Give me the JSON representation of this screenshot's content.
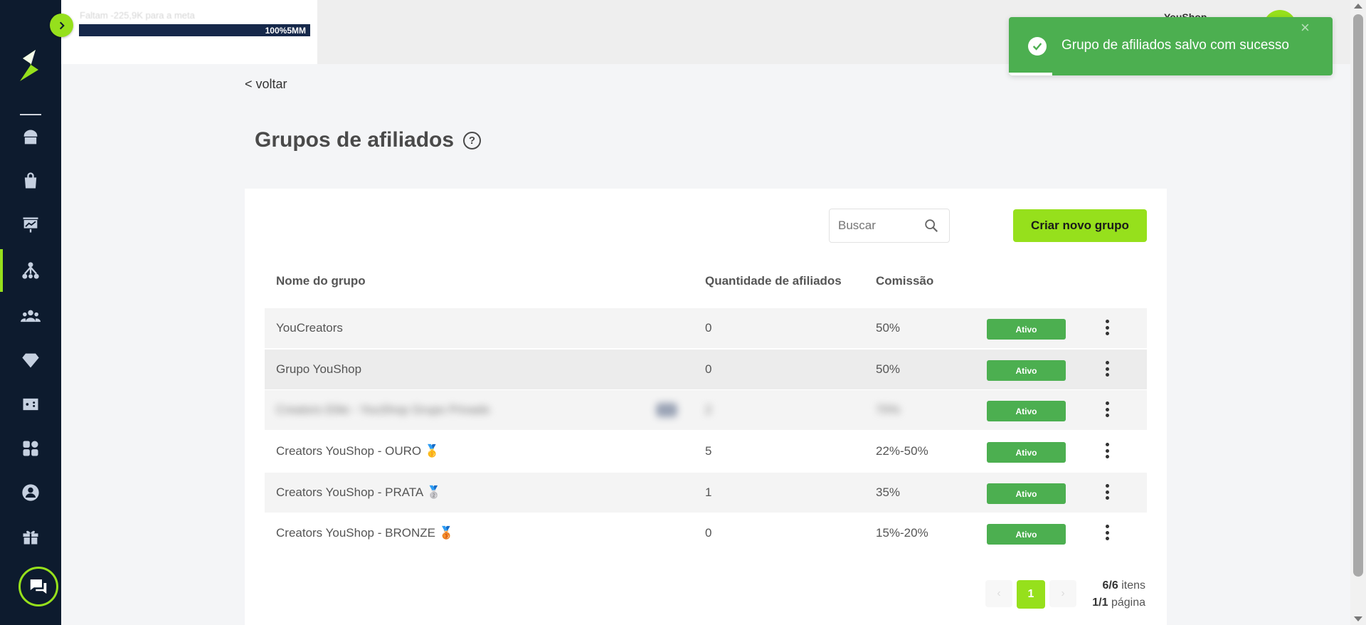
{
  "goal": {
    "text": "Faltam -225,9K para a meta",
    "percent": "100%",
    "target": "5MM"
  },
  "user": {
    "name": "YouShop"
  },
  "toast": {
    "message": "Grupo de afiliados salvo com sucesso",
    "close": "×"
  },
  "back_label": "< voltar",
  "page_title": "Grupos de afiliados",
  "help_symbol": "?",
  "search": {
    "placeholder": "Buscar"
  },
  "create_button": "Criar novo grupo",
  "table": {
    "headers": {
      "name": "Nome do grupo",
      "count": "Quantidade de afiliados",
      "commission": "Comissão"
    },
    "rows": [
      {
        "name": "YouCreators",
        "count": "0",
        "commission": "50%",
        "status": "Ativo"
      },
      {
        "name": "Grupo YouShop",
        "count": "0",
        "commission": "50%",
        "status": "Ativo"
      },
      {
        "name": "Creators Elite - YouShop Grupo Privado",
        "count": "2",
        "commission": "70%",
        "status": "Ativo"
      },
      {
        "name": "Creators YouShop - OURO 🥇",
        "count": "5",
        "commission": "22%-50%",
        "status": "Ativo"
      },
      {
        "name": "Creators YouShop - PRATA 🥈",
        "count": "1",
        "commission": "35%",
        "status": "Ativo"
      },
      {
        "name": "Creators YouShop - BRONZE 🥉",
        "count": "0",
        "commission": "15%-20%",
        "status": "Ativo"
      }
    ]
  },
  "pagination": {
    "current_page": "1",
    "items_count": "6/6",
    "items_label": "itens",
    "pages_count": "1/1",
    "pages_label": "página",
    "prev": "‹",
    "next": "›"
  },
  "colors": {
    "accent": "#96e01c",
    "sidebar": "#0d1b2e",
    "success": "#4caf50"
  }
}
